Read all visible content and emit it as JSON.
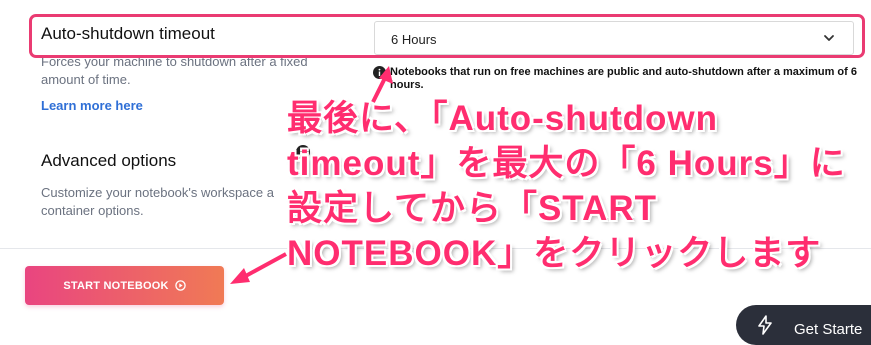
{
  "auto_shutdown": {
    "title": "Auto-shutdown timeout",
    "description": "Forces your machine to shutdown after a fixed amount of time.",
    "learn_more": "Learn more here",
    "selected_value": "6 Hours",
    "info": "Notebooks that run on free machines are public and auto-shutdown after a maximum of 6 hours."
  },
  "advanced": {
    "title": "Advanced options",
    "description": "Customize your notebook's workspace a container options."
  },
  "start_button": {
    "label": "START NOTEBOOK"
  },
  "annotation": {
    "text": "最後に、「Auto-shutdown timeout」を最大の「6 Hours」に設定してから「START NOTEBOOK」をクリックします",
    "color": "#ff2d6f"
  },
  "get_started": {
    "label": "Get Starte"
  },
  "colors": {
    "highlight_border": "#ea3b72",
    "link": "#2f6fd6",
    "button_gradient_start": "#e94580",
    "button_gradient_end": "#f07a55"
  }
}
